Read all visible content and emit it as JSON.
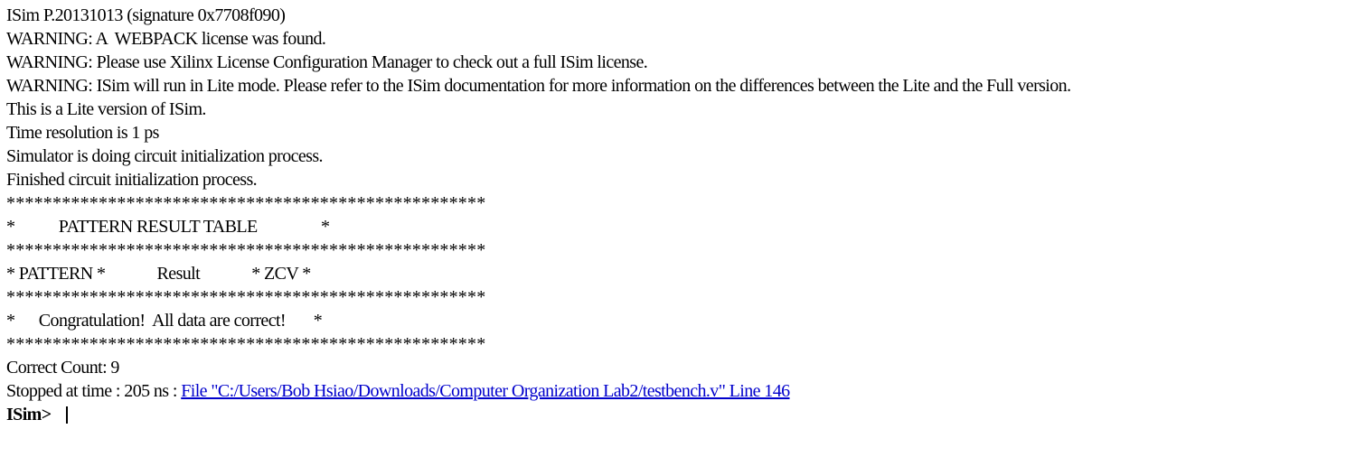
{
  "console": {
    "lines": [
      "ISim P.20131013 (signature 0x7708f090)",
      "WARNING: A  WEBPACK license was found.",
      "WARNING: Please use Xilinx License Configuration Manager to check out a full ISim license.",
      "WARNING: ISim will run in Lite mode. Please refer to the ISim documentation for more information on the differences between the Lite and the Full version.",
      "This is a Lite version of ISim.",
      "Time resolution is 1 ps",
      "Simulator is doing circuit initialization process.",
      "Finished circuit initialization process.",
      "****************************************************",
      "*           PATTERN RESULT TABLE                *",
      "****************************************************",
      "* PATTERN *             Result             * ZCV *",
      "****************************************************",
      "*      Congratulation!  All data are correct!       *",
      "****************************************************",
      "Correct Count: 9"
    ],
    "stopped_prefix": "Stopped at time : 205 ns : ",
    "stopped_link": "File \"C:/Users/Bob Hsiao/Downloads/Computer Organization Lab2/testbench.v\" Line 146",
    "prompt": "ISim>"
  }
}
